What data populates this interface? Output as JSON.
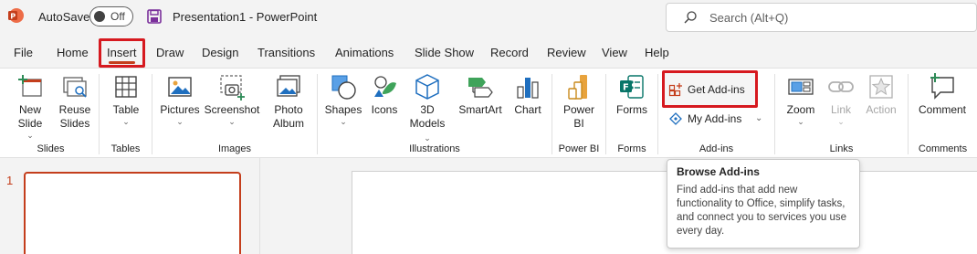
{
  "titlebar": {
    "autosave_label": "AutoSave",
    "toggle_state": "Off",
    "doc_title": "Presentation1  -  PowerPoint",
    "search_placeholder": "Search (Alt+Q)"
  },
  "tabs": [
    "File",
    "Home",
    "Insert",
    "Draw",
    "Design",
    "Transitions",
    "Animations",
    "Slide Show",
    "Record",
    "Review",
    "View",
    "Help"
  ],
  "active_tab": "Insert",
  "ribbon": {
    "slides": {
      "label": "Slides",
      "new_slide": "New\nSlide",
      "reuse_slides": "Reuse\nSlides"
    },
    "tables": {
      "label": "Tables",
      "table": "Table"
    },
    "images": {
      "label": "Images",
      "pictures": "Pictures",
      "screenshot": "Screenshot",
      "photo_album": "Photo\nAlbum"
    },
    "illustrations": {
      "label": "Illustrations",
      "shapes": "Shapes",
      "icons": "Icons",
      "models_3d": "3D\nModels",
      "smartart": "SmartArt",
      "chart": "Chart"
    },
    "powerbi": {
      "label": "Power BI",
      "power_bi": "Power\nBI"
    },
    "forms": {
      "label": "Forms",
      "forms": "Forms"
    },
    "addins": {
      "label": "Add-ins",
      "get_addins": "Get Add-ins",
      "my_addins": "My Add-ins"
    },
    "links": {
      "label": "Links",
      "zoom": "Zoom",
      "link": "Link",
      "action": "Action"
    },
    "comments": {
      "label": "Comments",
      "comment": "Comment"
    }
  },
  "slide_pane": {
    "slide_number": "1"
  },
  "tooltip": {
    "title": "Browse Add-ins",
    "body": "Find add-ins that add new functionality to Office, simplify tasks, and connect you to services you use every day."
  },
  "colors": {
    "accent": "#c43e1c",
    "highlight": "#d6191f"
  }
}
